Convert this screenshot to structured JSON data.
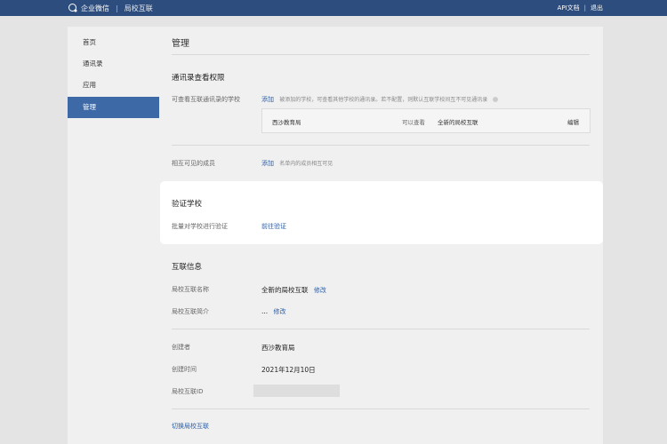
{
  "topbar": {
    "brand": "企业微信",
    "sub": "局校互联",
    "api_doc": "API文档",
    "logout": "退出"
  },
  "sidebar": {
    "items": [
      {
        "label": "首页"
      },
      {
        "label": "通讯录"
      },
      {
        "label": "应用"
      },
      {
        "label": "管理"
      }
    ],
    "active": "管理"
  },
  "main": {
    "title": "管理",
    "contacts_perm": {
      "title": "通讯录查看权限",
      "visible_schools_label": "可查看互联通讯录的学校",
      "add_link": "添加",
      "hint": "被添加的学校，可查看其他学校的通讯录。若不配置，则默认互联学校间互不可见通讯录",
      "row": {
        "name": "西沙教育局",
        "can_view": "可以查看",
        "target": "全新的局校互联",
        "edit": "编辑"
      },
      "mutual_label": "相互可见的成员",
      "mutual_add": "添加",
      "mutual_hint": "名单内的成员相互可见"
    },
    "verify": {
      "title": "验证学校",
      "label": "批量对学校进行验证",
      "link": "前往验证"
    },
    "info": {
      "title": "互联信息",
      "name_label": "局校互联名称",
      "name_value": "全新的局校互联",
      "name_edit": "修改",
      "intro_label": "局校互联简介",
      "intro_value": "...",
      "intro_edit": "修改",
      "creator_label": "创建者",
      "creator_value": "西沙教育局",
      "created_label": "创建时间",
      "created_value": "2021年12月10日",
      "id_label": "局校互联ID",
      "id_value": ""
    },
    "switch_link": "切换局校互联"
  }
}
